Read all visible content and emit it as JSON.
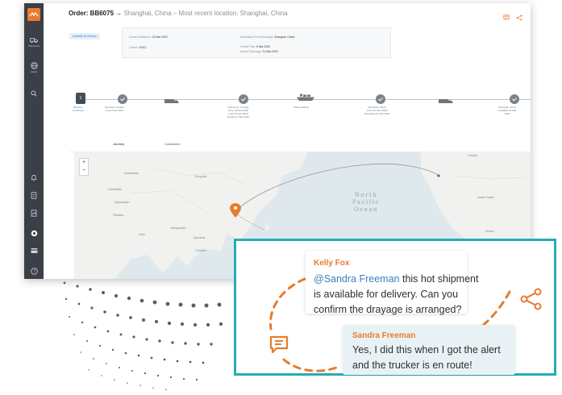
{
  "order": {
    "title": "Order: BB6075",
    "arrow": "→",
    "subtitle": "Shanghai, China – Most recent location: Shanghai, China"
  },
  "sidebar": {
    "items": [
      {
        "label": "Shipments",
        "icon": "truck-icon"
      },
      {
        "label": "Lanes",
        "icon": "globe-icon"
      },
      {
        "label": "",
        "icon": "search-icon"
      }
    ],
    "bottom_icons": [
      "bell-icon",
      "document-icon",
      "graph-icon",
      "circle-icon",
      "card-icon",
      "help-icon"
    ]
  },
  "status_badge": "Available for Delivery",
  "info": {
    "current_milestone_label": "Current Milestone:",
    "current_milestone": "23 Mar 2023",
    "carrier_label": "Carrier:",
    "carrier": "OOCL",
    "destination_label": "Destination Port Discharge:",
    "destination": "Shanghai, China",
    "carrier_plan_label": "Carrier Plan:",
    "carrier_plan": "6 Mar 2020",
    "actual_discharge_label": "Actual Discharge:",
    "actual_discharge": "21 Mar 2023"
  },
  "timeline": {
    "first_number": "1",
    "nodes": [
      {
        "line1": "Booking",
        "line2": "Confirmed",
        "line3": ""
      },
      {
        "line1": "Montreal, Canada",
        "line2": "Load 5 Feb 2020",
        "line3": ""
      },
      {
        "line1": "Vancouver, Canada",
        "line2": "Arrive 19 Feb 2020",
        "line3": "Load 25 Feb 2020"
      },
      {
        "line1": "OOCL Atlantic",
        "line2": "",
        "line3": ""
      },
      {
        "line1": "Shanghai, China",
        "line2": "Arrive 21 Mar 2020",
        "line3": "Discharge 21 Mar 2020"
      },
      {
        "line1": "Shanghai, China",
        "line2": "Available 23 Mar",
        "line3": "2020"
      }
    ],
    "extra_line": "Depart 27 Feb 2020"
  },
  "tabs": [
    {
      "label": "Journey",
      "active": true
    },
    {
      "label": "Containers",
      "active": false
    }
  ],
  "map": {
    "zoom_in": "+",
    "zoom_out": "−",
    "ocean_label_1": "North",
    "ocean_label_2": "Pacific",
    "ocean_label_3": "Ocean",
    "place_labels": [
      "Kazakhstan",
      "Mongolia",
      "Uzbekistan",
      "Afghanistan",
      "Pakistan",
      "India",
      "Bangladesh",
      "Myanmar",
      "Thailand",
      "Canada",
      "United States",
      "Mexico"
    ]
  },
  "chat": {
    "message1": {
      "sender": "Kelly Fox",
      "mention": "@Sandra Freeman",
      "line1_rest": " this hot shipment",
      "line2": "is available for delivery. Can you",
      "line3": "confirm the drayage is arranged?"
    },
    "message2": {
      "sender": "Sandra Freeman",
      "line1": "Yes, I did this when I got the alert",
      "line2": "and the trucker is en route!"
    }
  },
  "colors": {
    "accent": "#e87b2e",
    "teal": "#25adb5",
    "sidebar": "#3b3f46",
    "mention": "#3c7fc1"
  }
}
